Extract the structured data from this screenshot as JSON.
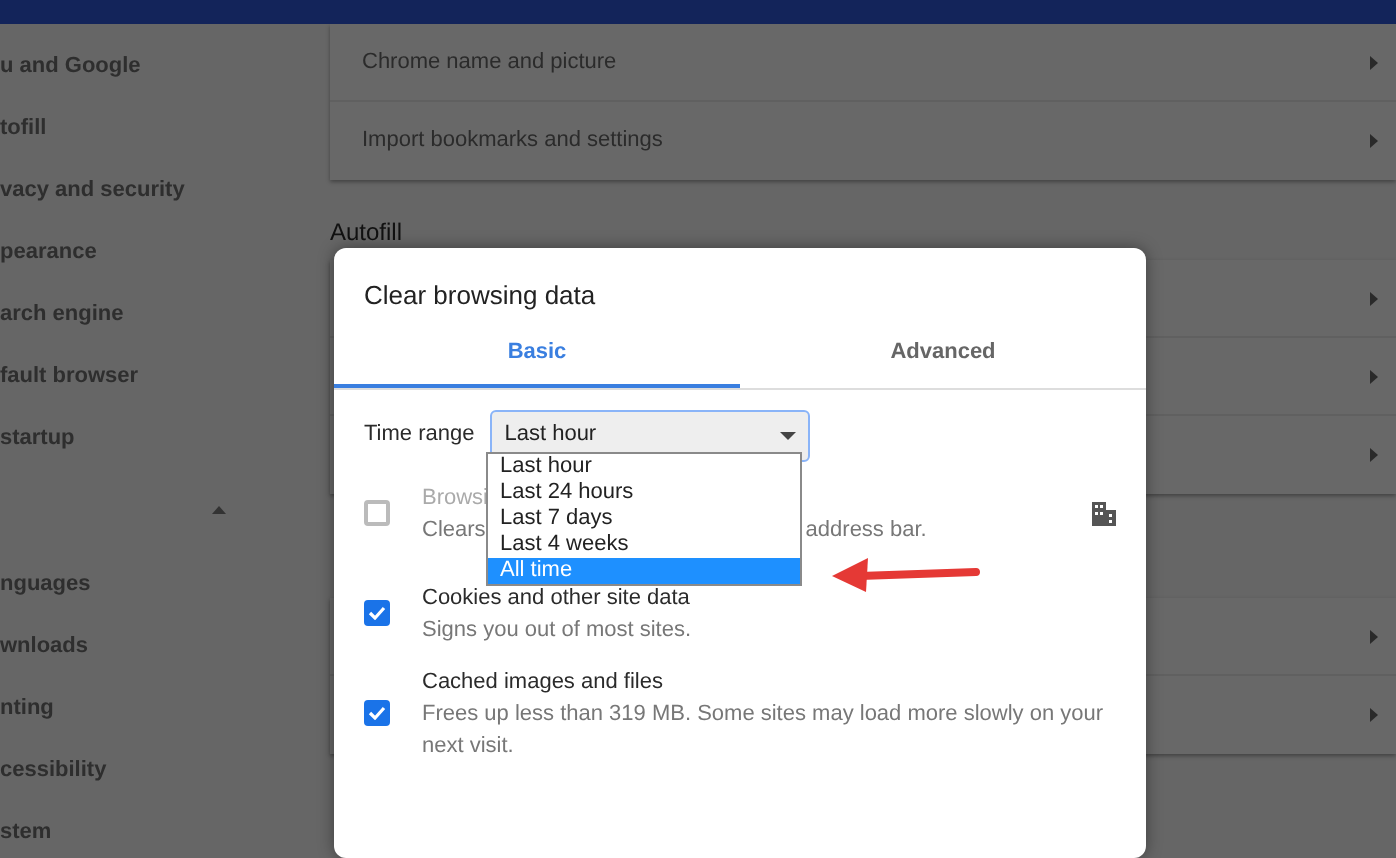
{
  "sidebar": {
    "items": [
      {
        "label": "u and Google"
      },
      {
        "label": "tofill"
      },
      {
        "label": "vacy and security"
      },
      {
        "label": "pearance"
      },
      {
        "label": "arch engine"
      },
      {
        "label": "fault browser"
      },
      {
        "label": "startup"
      },
      {
        "kind": "collapse"
      },
      {
        "label": "nguages"
      },
      {
        "label": "wnloads"
      },
      {
        "label": "nting"
      },
      {
        "label": "cessibility"
      },
      {
        "label": "stem"
      }
    ]
  },
  "main": {
    "sections": [
      {
        "rows": [
          {
            "label": "Chrome name and picture"
          },
          {
            "label": "Import bookmarks and settings"
          }
        ]
      },
      {
        "heading": "Autofill",
        "rows": [
          {
            "arrow": true
          },
          {
            "arrow": true
          },
          {
            "arrow": true
          }
        ]
      },
      {
        "rows": [
          {
            "arrow": true
          },
          {
            "arrow": true
          }
        ]
      }
    ]
  },
  "dialog": {
    "title": "Clear browsing data",
    "tabs": [
      {
        "label": "Basic",
        "selected": true
      },
      {
        "label": "Advanced",
        "selected": false
      }
    ],
    "time_range": {
      "label": "Time range",
      "value": "Last hour",
      "expanded": true,
      "options": [
        {
          "label": "Last hour",
          "highlighted": false
        },
        {
          "label": "Last 24 hours",
          "highlighted": false
        },
        {
          "label": "Last 7 days",
          "highlighted": false
        },
        {
          "label": "Last 4 weeks",
          "highlighted": false
        },
        {
          "label": "All time",
          "highlighted": true
        }
      ]
    },
    "items": [
      {
        "title": "Browsi",
        "description": [
          "Clears",
          "address bar."
        ],
        "checked": false,
        "managed": true
      },
      {
        "title": "Cookies and other site data",
        "description": [
          "Signs you out of most sites."
        ],
        "checked": true,
        "managed": false
      },
      {
        "title": "Cached images and files",
        "description": [
          "Frees up less than 319 MB. Some sites may load more slowly on your next visit."
        ],
        "checked": true,
        "managed": false
      }
    ]
  }
}
